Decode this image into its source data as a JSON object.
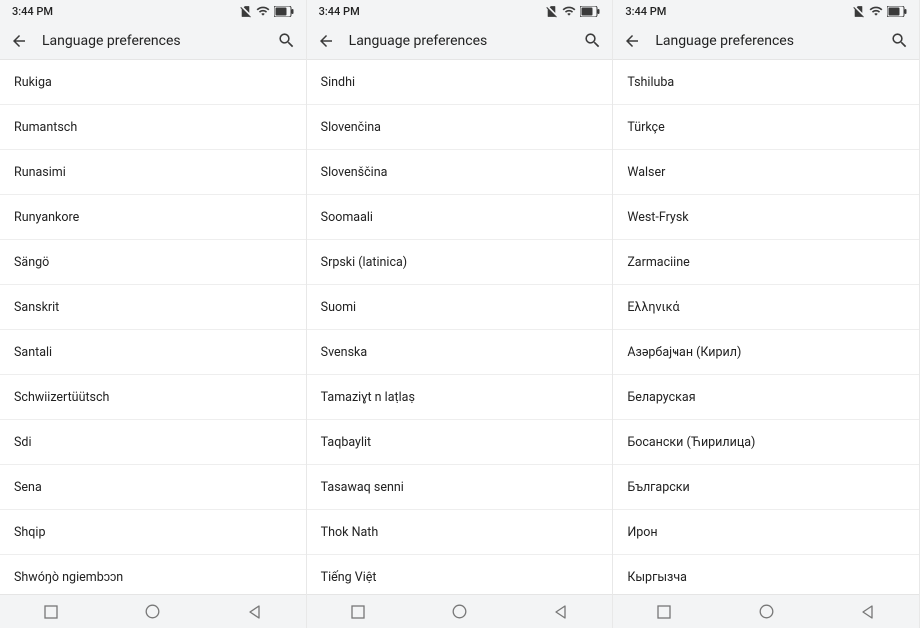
{
  "status": {
    "time": "3:44 PM"
  },
  "header": {
    "title": "Language preferences"
  },
  "screens": [
    {
      "items": [
        "Rukiga",
        "Rumantsch",
        "Runasimi",
        "Runyankore",
        "Sängö",
        "Sanskrit",
        "Santali",
        "Schwiizertüütsch",
        "Sdi",
        "Sena",
        "Shqip",
        "Shwóŋò ngiembɔɔn"
      ]
    },
    {
      "items": [
        "Sindhi",
        "Slovenčina",
        "Slovenščina",
        "Soomaali",
        "Srpski (latinica)",
        "Suomi",
        "Svenska",
        "Tamaziɣt n laṭlaṣ",
        "Taqbaylit",
        "Tasawaq senni",
        "Thok Nath",
        "Tiếng Việt"
      ]
    },
    {
      "items": [
        "Tshiluba",
        "Türkçe",
        "Walser",
        "West-Frysk",
        "Zarmaciine",
        "Ελληνικά",
        "Азәрбајҹан (Кирил)",
        "Беларуская",
        "Босански (Ћирилица)",
        "Български",
        "Ирон",
        "Кыргызча"
      ]
    }
  ]
}
